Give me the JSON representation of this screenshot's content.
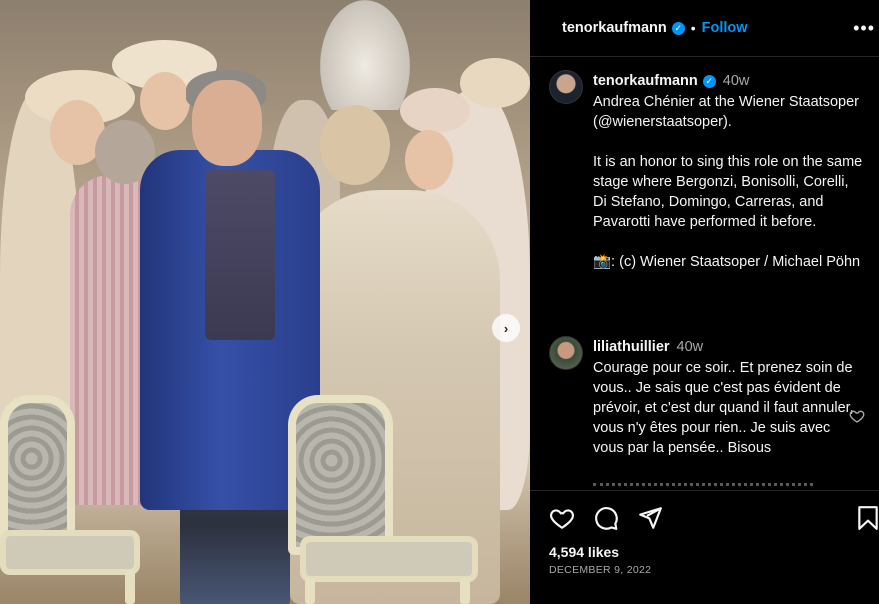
{
  "post": {
    "author": "tenorkaufmann",
    "follow_label": "Follow",
    "separator": "•",
    "more_label": "•••",
    "carousel_next": "›"
  },
  "caption": {
    "username": "tenorkaufmann",
    "time": "40w",
    "paragraphs": [
      "Andrea Chénier at the Wiener Staatsoper (@wienerstaatsoper).",
      "It is an honor to sing this role on the same stage where Bergonzi, Bonisolli, Corelli, Di Stefano, Domingo, Carreras, and Pavarotti have performed it before.",
      "📸: (c) Wiener Staatsoper / Michael Pöhn"
    ]
  },
  "comments": [
    {
      "username": "liliathuillier",
      "time": "40w",
      "text": "Courage pour ce soir.. Et prenez soin de vous.. Je sais que c'est pas évident de prévoir, et c'est dur quand il faut annuler, vous n'y êtes pour rien.. Je suis avec vous par la pensée.. Bisous"
    }
  ],
  "actions": {
    "icons": [
      "heart-icon",
      "comment-icon",
      "share-icon",
      "bookmark-icon"
    ],
    "likes": "4,594 likes",
    "date": "DECEMBER 9, 2022"
  },
  "colors": {
    "accent": "#0095f6",
    "background": "#000000",
    "text": "#f5f5f5",
    "muted": "#a8a8a8",
    "divider": "#262626"
  }
}
